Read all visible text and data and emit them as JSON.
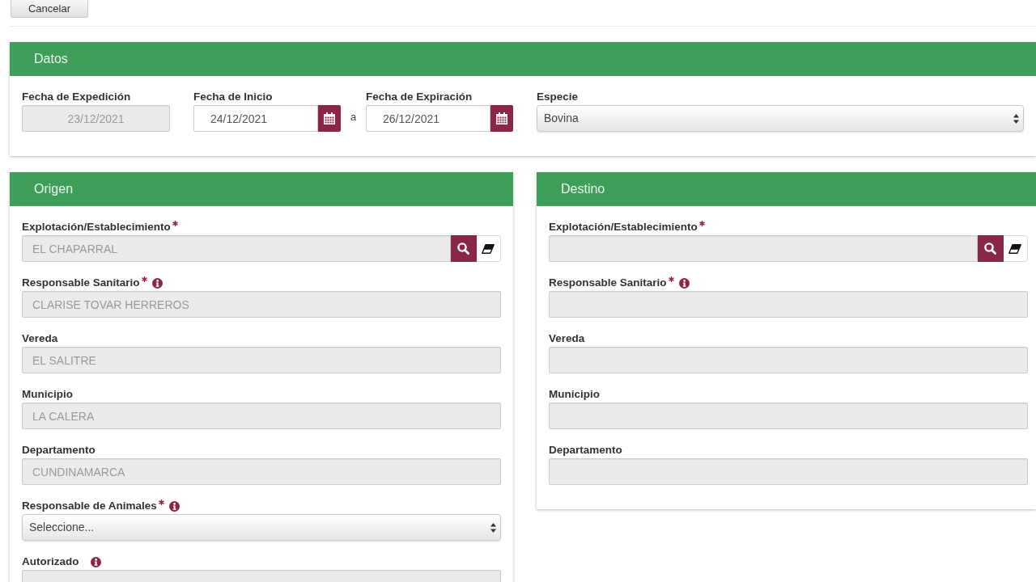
{
  "top_actions": {
    "cancel_button": "Cancelar"
  },
  "datos": {
    "title": "Datos",
    "fields": [
      {
        "kind": "date",
        "label": "Fecha de Expedición",
        "value": "23/12/2021",
        "disabled": true,
        "calendar": false
      },
      {
        "kind": "date",
        "label": "Fecha de Inicio",
        "value": "24/12/2021",
        "disabled": false,
        "calendar": true
      },
      {
        "kind": "range_separator",
        "text": "a"
      },
      {
        "kind": "date",
        "label": "Fecha de Expiración",
        "value": "26/12/2021",
        "disabled": false,
        "calendar": true
      },
      {
        "kind": "select",
        "label": "Especie",
        "value": "Bovina"
      }
    ]
  },
  "origen": {
    "title": "Origen",
    "fields": [
      {
        "kind": "lookup",
        "label": "Explotación/Establecimiento",
        "required": true,
        "info": false,
        "value": "EL CHAPARRAL",
        "disabled": true
      },
      {
        "kind": "text",
        "label": "Responsable Sanitario",
        "required": true,
        "info": true,
        "value": "CLARISE TOVAR HERREROS",
        "disabled": true
      },
      {
        "kind": "text",
        "label": "Vereda",
        "required": false,
        "info": false,
        "value": "EL SALITRE",
        "disabled": true
      },
      {
        "kind": "text",
        "label": "Municipio",
        "required": false,
        "info": false,
        "value": "LA CALERA",
        "disabled": true
      },
      {
        "kind": "text",
        "label": "Departamento",
        "required": false,
        "info": false,
        "value": "CUNDINAMARCA",
        "disabled": true
      },
      {
        "kind": "select",
        "label": "Responsable de Animales",
        "required": true,
        "info": true,
        "placeholder": "Seleccione..."
      },
      {
        "kind": "text",
        "label": "Autorizado",
        "required": false,
        "info": true,
        "disabled": true
      }
    ]
  },
  "destino": {
    "title": "Destino",
    "fields": [
      {
        "kind": "lookup",
        "label": "Explotación/Establecimiento",
        "required": true,
        "info": false,
        "disabled": true
      },
      {
        "kind": "text",
        "label": "Responsable Sanitario",
        "required": true,
        "info": true,
        "disabled": true
      },
      {
        "kind": "text",
        "label": "Vereda",
        "required": false,
        "info": false,
        "disabled": true
      },
      {
        "kind": "text",
        "label": "Municipio",
        "required": false,
        "info": false,
        "disabled": true
      },
      {
        "kind": "text",
        "label": "Departamento",
        "required": false,
        "info": false,
        "disabled": true
      }
    ]
  }
}
